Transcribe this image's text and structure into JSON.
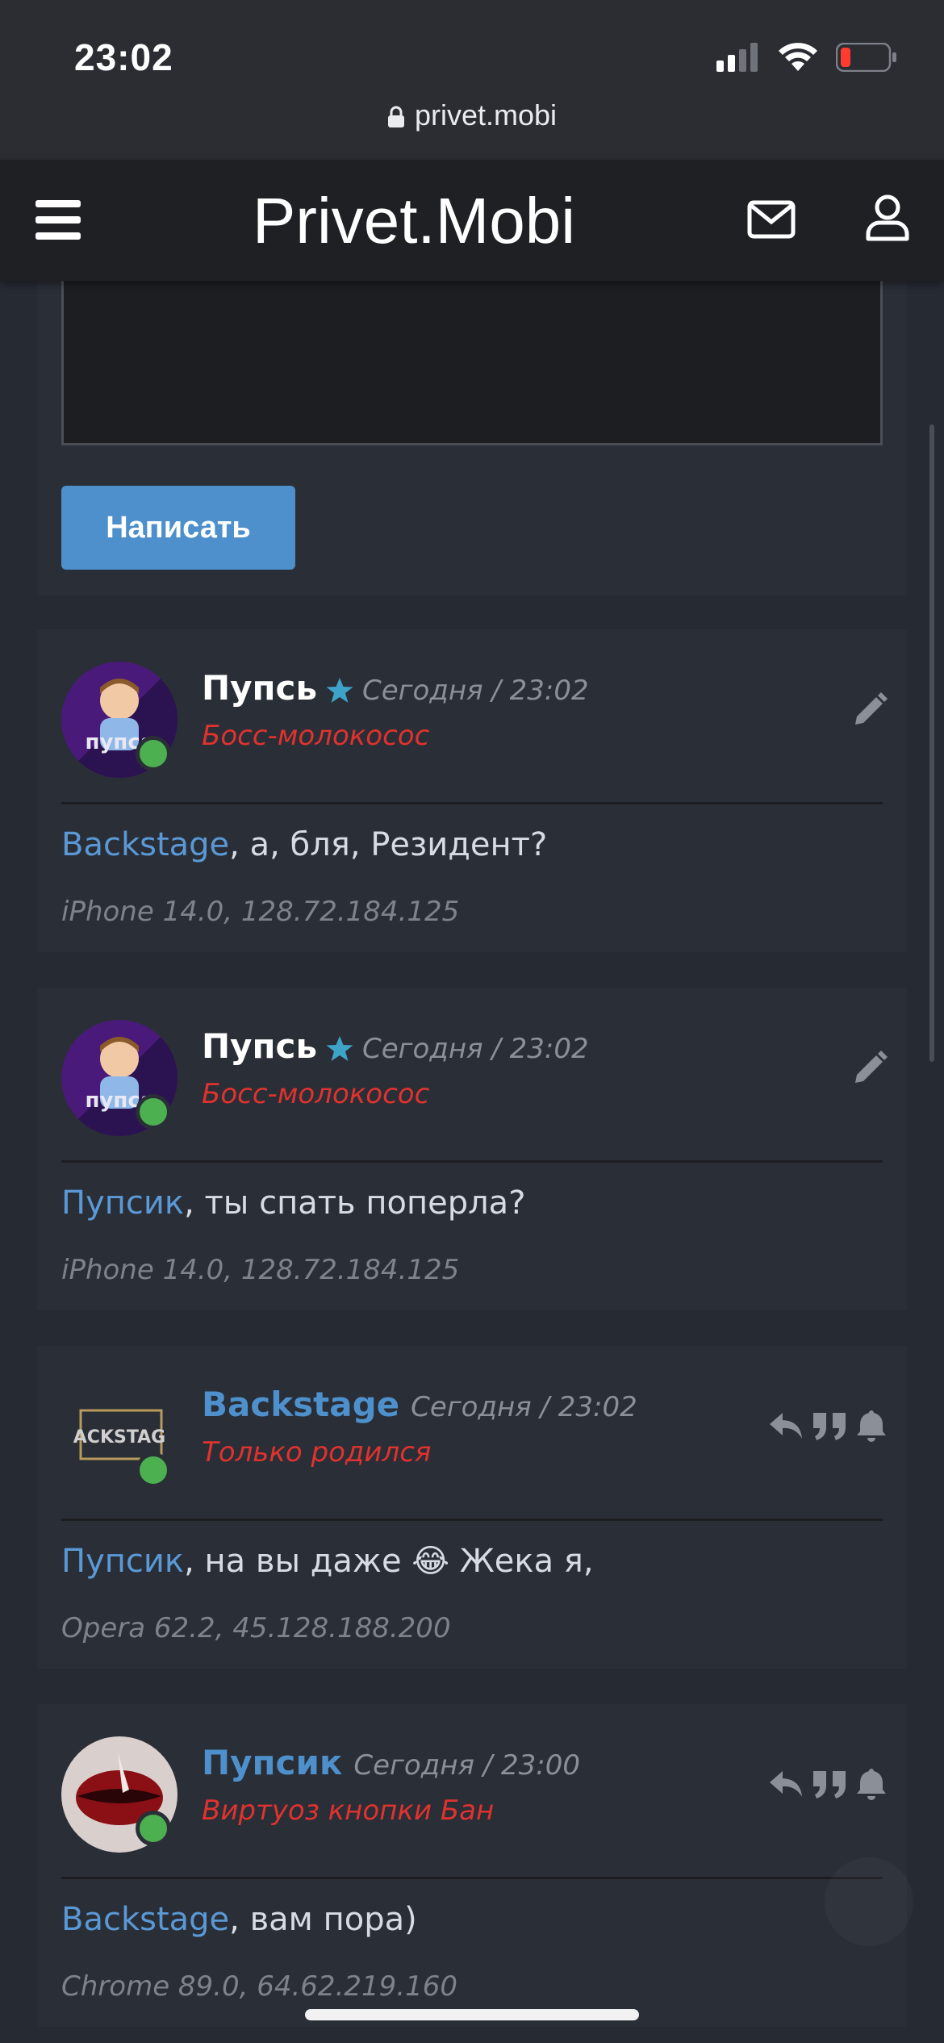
{
  "status_bar": {
    "time": "23:02",
    "url": "privet.mobi"
  },
  "header": {
    "title": "Privet.Mobi"
  },
  "editor": {
    "submit_label": "Написать"
  },
  "posts": [
    {
      "author": "Пупсь",
      "date": "Сегодня / 23:02",
      "rank": "Босс-молокосос",
      "mention": "Backstage",
      "text": ", а, бля, Резидент?",
      "meta": "iPhone 14.0, 128.72.184.125",
      "name_color": "#ffffff",
      "avatar": "pupsya-avatar",
      "online": true,
      "controls": "edit"
    },
    {
      "author": "Пупсь",
      "date": "Сегодня / 23:02",
      "rank": "Босс-молокосос",
      "mention": "Пупсик",
      "text": ", ты спать поперла?",
      "meta": "iPhone 14.0, 128.72.184.125",
      "name_color": "#ffffff",
      "avatar": "pupsya-avatar",
      "online": true,
      "controls": "edit"
    },
    {
      "author": "Backstage",
      "date": "Сегодня / 23:02",
      "rank": "Только родился",
      "mention": "Пупсик",
      "text": ", на вы даже 😂 Жека я,",
      "meta": "Opera 62.2, 45.128.188.200",
      "name_color": "#4d90cc",
      "avatar": "backstage-avatar",
      "avatar_text": "ACKSTAG",
      "online": true,
      "controls": "reply-quote-notify"
    },
    {
      "author": "Пупсик",
      "date": "Сегодня / 23:00",
      "rank": "Виртуоз кнопки Бан",
      "mention": "Backstage",
      "text": ", вам пора)",
      "meta": "Chrome 89.0, 64.62.219.160",
      "name_color": "#4d90cc",
      "avatar": "lips-avatar",
      "online": true,
      "controls": "reply-quote-notify"
    }
  ],
  "colors": {
    "accent": "#4d90cc",
    "rank_red": "#e0322e",
    "online": "#4caf50",
    "star": "#3ea3c8"
  }
}
